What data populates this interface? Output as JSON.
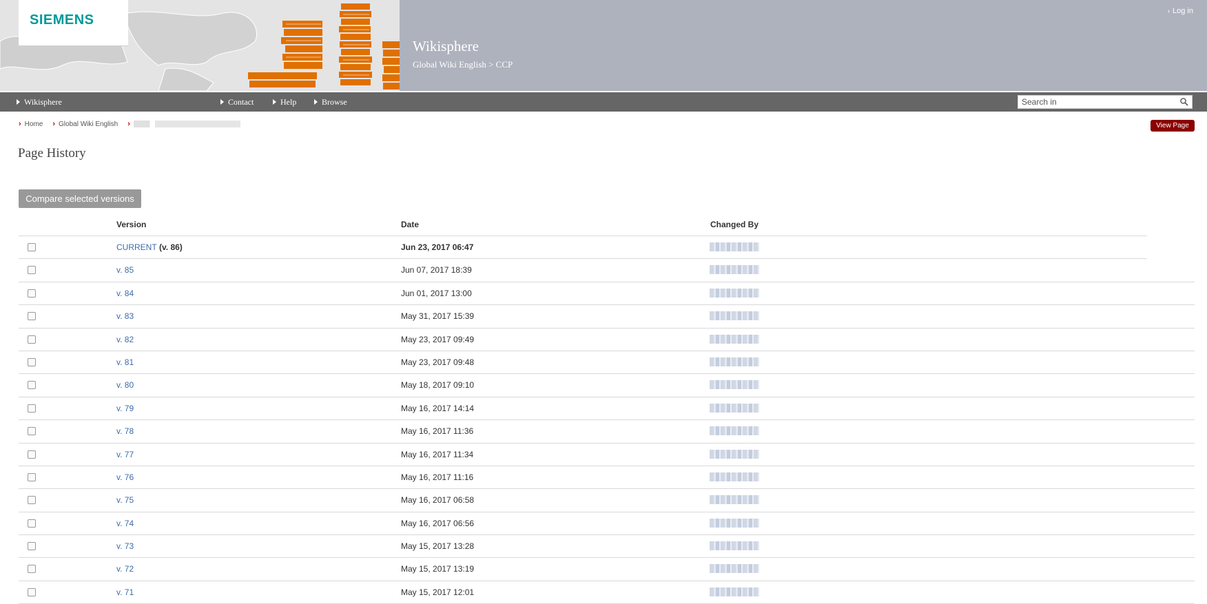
{
  "header": {
    "logo": "SIEMENS",
    "site_title": "Wikisphere",
    "site_crumb": "Global Wiki English > CCP",
    "login": "Log in"
  },
  "nav": {
    "items": [
      "Wikisphere",
      "Contact",
      "Help",
      "Browse"
    ],
    "search_placeholder": "Search in"
  },
  "breadcrumb": {
    "home": "Home",
    "space": "Global Wiki English"
  },
  "view_page": "View Page",
  "page_title": "Page History",
  "compare_button": "Compare selected versions",
  "table": {
    "headers": {
      "version": "Version",
      "date": "Date",
      "changed_by": "Changed By"
    },
    "rows": [
      {
        "version": "CURRENT",
        "extra": " (v. 86)",
        "date": "Jun 23, 2017 06:47"
      },
      {
        "version": "v. 85",
        "date": "Jun 07, 2017 18:39"
      },
      {
        "version": "v. 84",
        "date": "Jun 01, 2017 13:00"
      },
      {
        "version": "v. 83",
        "date": "May 31, 2017 15:39"
      },
      {
        "version": "v. 82",
        "date": "May 23, 2017 09:49"
      },
      {
        "version": "v. 81",
        "date": "May 23, 2017 09:48"
      },
      {
        "version": "v. 80",
        "date": "May 18, 2017 09:10"
      },
      {
        "version": "v. 79",
        "date": "May 16, 2017 14:14"
      },
      {
        "version": "v. 78",
        "date": "May 16, 2017 11:36"
      },
      {
        "version": "v. 77",
        "date": "May 16, 2017 11:34"
      },
      {
        "version": "v. 76",
        "date": "May 16, 2017 11:16"
      },
      {
        "version": "v. 75",
        "date": "May 16, 2017 06:58"
      },
      {
        "version": "v. 74",
        "date": "May 16, 2017 06:56"
      },
      {
        "version": "v. 73",
        "date": "May 15, 2017 13:28"
      },
      {
        "version": "v. 72",
        "date": "May 15, 2017 13:19"
      },
      {
        "version": "v. 71",
        "date": "May 15, 2017 12:01"
      }
    ]
  },
  "colors": {
    "header_gray": "#aeb2bd",
    "nav_gray": "#666666",
    "siemens_teal": "#009999",
    "accent_red": "#8b0000",
    "books_orange": "#e07000",
    "link_blue": "#3d6aa8"
  }
}
